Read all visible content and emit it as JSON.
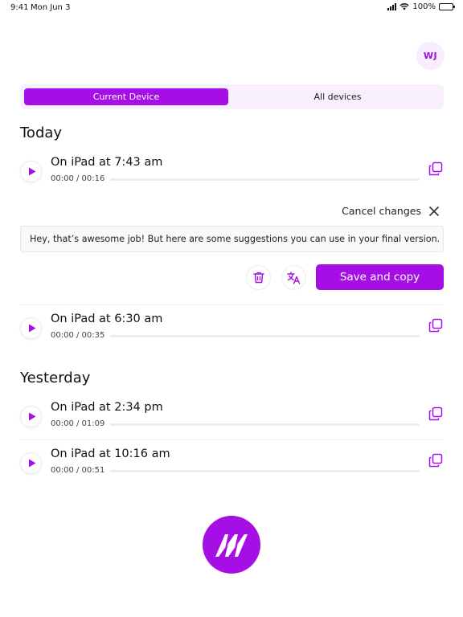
{
  "status": {
    "time": "9:41",
    "date": "Mon Jun 3",
    "battery": "100%"
  },
  "user": {
    "initials": "WJ"
  },
  "tabs": {
    "current": "Current Device",
    "all": "All devices"
  },
  "sections": {
    "today": "Today",
    "yesterday": "Yesterday"
  },
  "recordings": [
    {
      "title": "On iPad at 7:43 am",
      "time": "00:00 / 00:16"
    },
    {
      "title": "On iPad at 6:30 am",
      "time": "00:00 / 00:35"
    },
    {
      "title": "On iPad at 2:34 pm",
      "time": "00:00 / 01:09"
    },
    {
      "title": "On iPad at 10:16 am",
      "time": "00:00 / 00:51"
    }
  ],
  "editor": {
    "cancel_label": "Cancel changes",
    "text": "Hey, that’s awesome job! But here are some suggestions you can use in your final version.",
    "save_label": "Save and copy"
  },
  "colors": {
    "accent": "#a50fe6",
    "accent_light": "#f8efff"
  }
}
